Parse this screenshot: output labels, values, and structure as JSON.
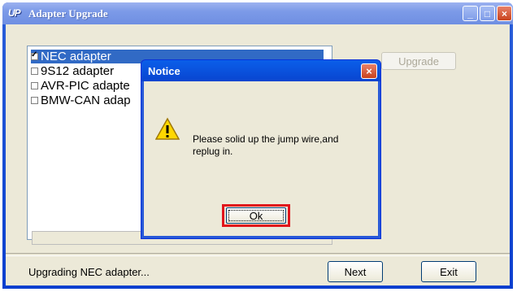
{
  "window": {
    "app_logo": "UP",
    "title": "Adapter Upgrade",
    "minimize": "_",
    "maximize": "□",
    "close": "×"
  },
  "adapters": [
    {
      "label": "NEC adapter",
      "checked": true,
      "selected": true
    },
    {
      "label": "9S12 adapter",
      "checked": false,
      "selected": false
    },
    {
      "label": "AVR-PIC adapte",
      "checked": false,
      "selected": false
    },
    {
      "label": "BMW-CAN adap",
      "checked": false,
      "selected": false
    }
  ],
  "buttons": {
    "upgrade": "Upgrade",
    "next": "Next",
    "exit": "Exit"
  },
  "status": "Upgrading NEC adapter...",
  "dialog": {
    "title": "Notice",
    "close": "×",
    "message_line1": "Please solid up the jump wire,and",
    "message_line2": "replug in.",
    "ok": "Ok",
    "icon": "warning-icon"
  },
  "colors": {
    "titlebar": "#7c9ae8",
    "dialog_titlebar": "#0a5fe9",
    "selection": "#316ac5",
    "highlight_box": "#e1141b"
  }
}
